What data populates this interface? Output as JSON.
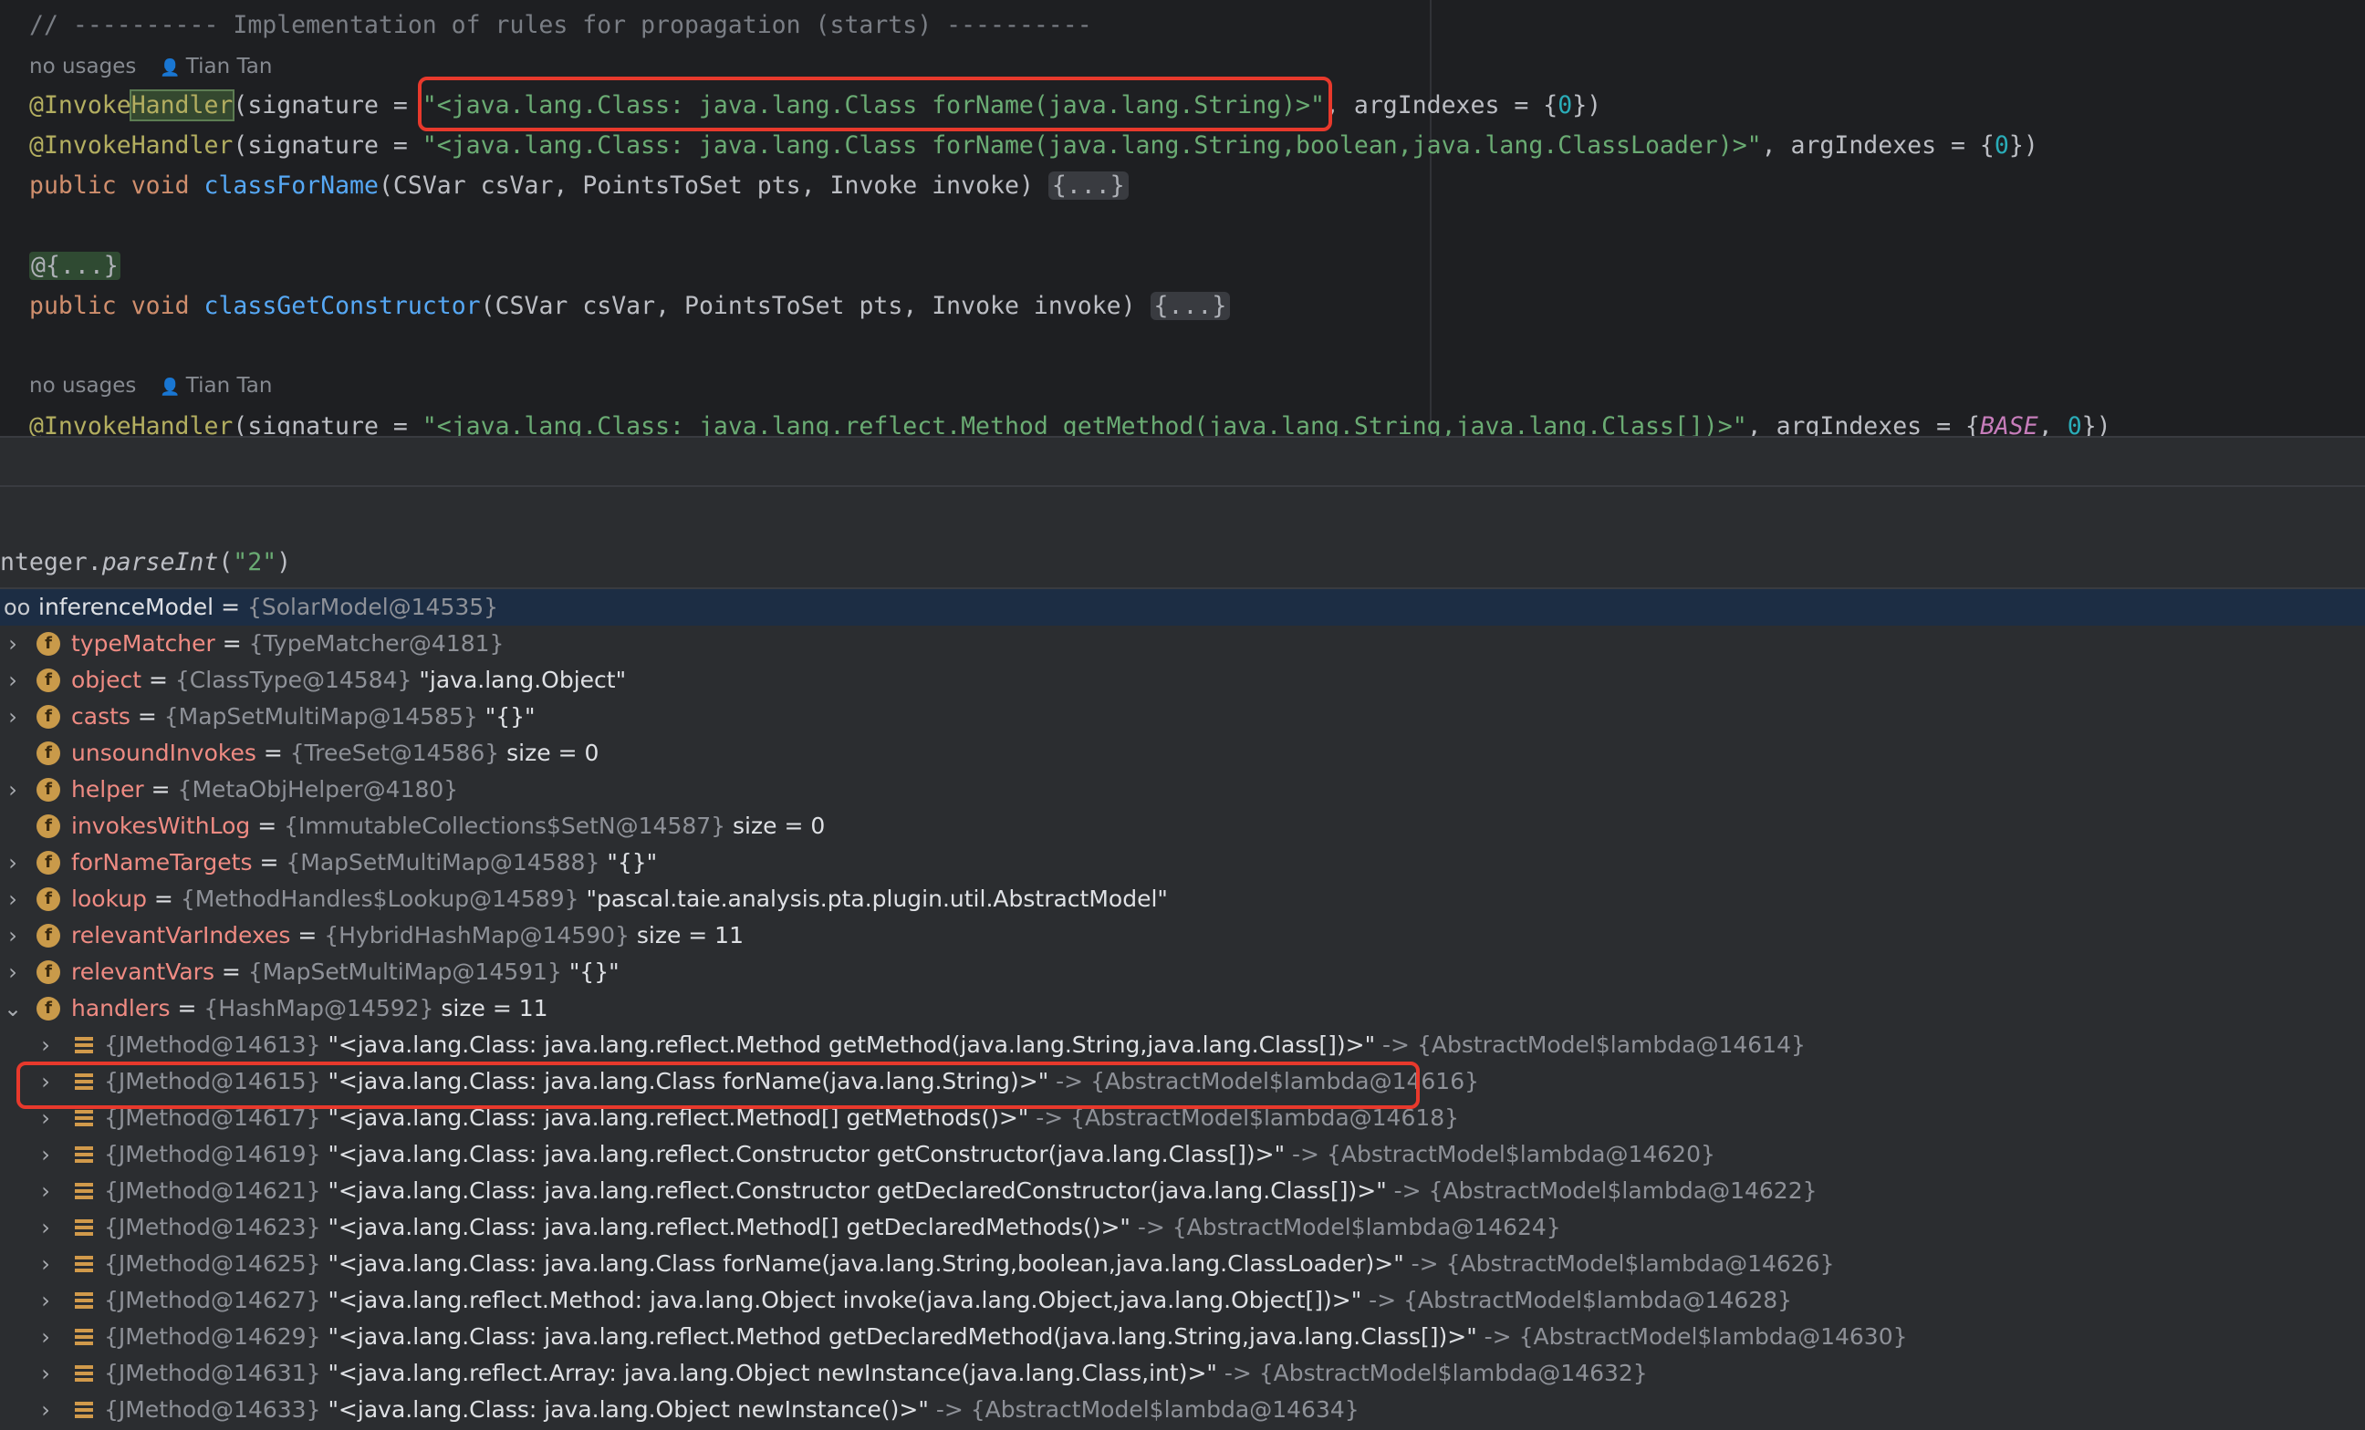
{
  "editor": {
    "comment": "// ---------- Implementation of rules for propagation (starts) ----------",
    "usages1": "no usages",
    "author1": "Tian Tan",
    "ann": "@Invoke",
    "ann_hl": "Handler",
    "sig_open": "(signature = ",
    "sig1": "\"<java.lang.Class: java.lang.Class forName(java.lang.String)>\"",
    "argIdx_prefix": ", argIndexes = {",
    "zero": "0",
    "argIdx_suffix": "})",
    "sig2": "\"<java.lang.Class: java.lang.Class forName(java.lang.String,boolean,java.lang.ClassLoader)>\"",
    "kw_public": "public",
    "kw_void": "void",
    "m1_name": "classForName",
    "params": "(CSVar csVar, PointsToSet pts, Invoke invoke) ",
    "fold": "{...}",
    "fold_ann": "@{...}",
    "m2_name": "classGetConstructor",
    "usages2": "no usages",
    "author2": "Tian Tan",
    "sig3": "\"<java.lang.Class: java.lang.reflect.Method getMethod(java.lang.String,java.lang.Class[])>\"",
    "base": "BASE",
    "comma_sp": ", "
  },
  "debugger": {
    "eval_prefix": "nteger.",
    "eval_method": "parseInt",
    "eval_paren_open": "(",
    "eval_arg": "\"2\"",
    "eval_paren_close": ")",
    "root": {
      "name": "inferenceModel",
      "eq": " = ",
      "ref": "{SolarModel@14535}"
    },
    "fields": [
      {
        "name": "typeMatcher",
        "ref": "{TypeMatcher@4181}",
        "val": "",
        "expandable": true
      },
      {
        "name": "object",
        "ref": "{ClassType@14584}",
        "val": "\"java.lang.Object\"",
        "expandable": true
      },
      {
        "name": "casts",
        "ref": "{MapSetMultiMap@14585}",
        "val": "\"{}\"",
        "expandable": true
      },
      {
        "name": "unsoundInvokes",
        "ref": "{TreeSet@14586}",
        "val": " size = 0",
        "expandable": false
      },
      {
        "name": "helper",
        "ref": "{MetaObjHelper@4180}",
        "val": "",
        "expandable": true
      },
      {
        "name": "invokesWithLog",
        "ref": "{ImmutableCollections$SetN@14587}",
        "val": " size = 0",
        "expandable": false
      },
      {
        "name": "forNameTargets",
        "ref": "{MapSetMultiMap@14588}",
        "val": "\"{}\"",
        "expandable": true
      },
      {
        "name": "lookup",
        "ref": "{MethodHandles$Lookup@14589}",
        "val": "\"pascal.taie.analysis.pta.plugin.util.AbstractModel\"",
        "expandable": true
      },
      {
        "name": "relevantVarIndexes",
        "ref": "{HybridHashMap@14590}",
        "val": " size = 11",
        "expandable": true
      },
      {
        "name": "relevantVars",
        "ref": "{MapSetMultiMap@14591}",
        "val": "\"{}\"",
        "expandable": true
      },
      {
        "name": "handlers",
        "ref": "{HashMap@14592}",
        "val": " size = 11",
        "expandable": true,
        "expanded": true
      }
    ],
    "entries": [
      {
        "key": "{JMethod@14613}",
        "sig": "\"<java.lang.Class: java.lang.reflect.Method getMethod(java.lang.String,java.lang.Class[])>\"",
        "val": "{AbstractModel$lambda@14614}"
      },
      {
        "key": "{JMethod@14615}",
        "sig": "\"<java.lang.Class: java.lang.Class forName(java.lang.String)>\"",
        "val": "{AbstractModel$lambda@14616}"
      },
      {
        "key": "{JMethod@14617}",
        "sig": "\"<java.lang.Class: java.lang.reflect.Method[] getMethods()>\"",
        "val": "{AbstractModel$lambda@14618}"
      },
      {
        "key": "{JMethod@14619}",
        "sig": "\"<java.lang.Class: java.lang.reflect.Constructor getConstructor(java.lang.Class[])>\"",
        "val": "{AbstractModel$lambda@14620}"
      },
      {
        "key": "{JMethod@14621}",
        "sig": "\"<java.lang.Class: java.lang.reflect.Constructor getDeclaredConstructor(java.lang.Class[])>\"",
        "val": "{AbstractModel$lambda@14622}"
      },
      {
        "key": "{JMethod@14623}",
        "sig": "\"<java.lang.Class: java.lang.reflect.Method[] getDeclaredMethods()>\"",
        "val": "{AbstractModel$lambda@14624}"
      },
      {
        "key": "{JMethod@14625}",
        "sig": "\"<java.lang.Class: java.lang.Class forName(java.lang.String,boolean,java.lang.ClassLoader)>\"",
        "val": "{AbstractModel$lambda@14626}"
      },
      {
        "key": "{JMethod@14627}",
        "sig": "\"<java.lang.reflect.Method: java.lang.Object invoke(java.lang.Object,java.lang.Object[])>\"",
        "val": "{AbstractModel$lambda@14628}"
      },
      {
        "key": "{JMethod@14629}",
        "sig": "\"<java.lang.Class: java.lang.reflect.Method getDeclaredMethod(java.lang.String,java.lang.Class[])>\"",
        "val": "{AbstractModel$lambda@14630}"
      },
      {
        "key": "{JMethod@14631}",
        "sig": "\"<java.lang.reflect.Array: java.lang.Object newInstance(java.lang.Class,int)>\"",
        "val": "{AbstractModel$lambda@14632}"
      },
      {
        "key": "{JMethod@14633}",
        "sig": "\"<java.lang.Class: java.lang.Object newInstance()>\"",
        "val": "{AbstractModel$lambda@14634}"
      }
    ],
    "eq": " = ",
    "arrow": " -> "
  },
  "icons": {
    "field": "f",
    "expand": "›",
    "expanded": "⌄",
    "watch": "oo"
  },
  "colors": {
    "highlight_box": "#e8392c",
    "selection": "#1c2d44"
  }
}
